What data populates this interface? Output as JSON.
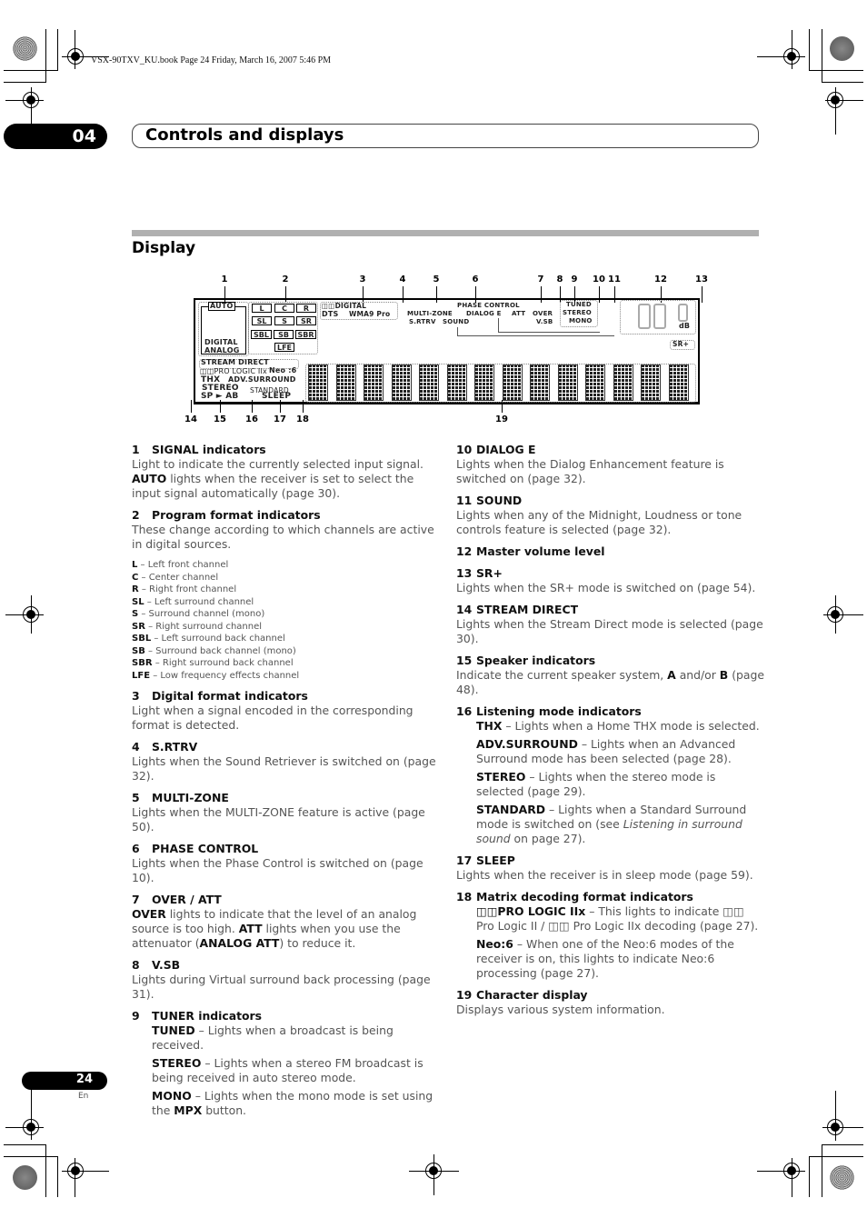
{
  "print_header": "VSX-90TXV_KU.book  Page 24  Friday, March 16, 2007  5:46 PM",
  "chapter": {
    "number": "04",
    "title": "Controls and displays"
  },
  "section": {
    "title": "Display"
  },
  "diagram": {
    "callouts_top": [
      "1",
      "2",
      "3",
      "4",
      "5",
      "6",
      "7",
      "8",
      "9",
      "10",
      "11",
      "12",
      "13"
    ],
    "callouts_bottom": [
      "14",
      "15",
      "16",
      "17",
      "18",
      "19"
    ],
    "indicators": {
      "auto": "AUTO",
      "digital": "DIGITAL",
      "analog": "ANALOG",
      "channels": [
        "L",
        "C",
        "R",
        "SL",
        "S",
        "SR",
        "SBL",
        "SB",
        "SBR",
        "LFE"
      ],
      "dd_digital": "◫◫DIGITAL",
      "dts": "DTS",
      "wma9": "WMA9 Pro",
      "multi_zone": "MULTI-ZONE",
      "s_rtrv": "S.RTRV",
      "sound": "SOUND",
      "phase_control": "PHASE CONTROL",
      "dialog_e": "DIALOG E",
      "att": "ATT",
      "over": "OVER",
      "vsb": "V.SB",
      "tuned": "TUNED",
      "stereo_tuner": "STEREO",
      "mono": "MONO",
      "db": "dB",
      "sr_plus": "SR+",
      "stream_direct": "STREAM DIRECT",
      "pro_logic": "◫◫PRO LOGIC IIx",
      "neo6": "Neo :6",
      "thx": "THX",
      "adv_surround": "ADV.SURROUND",
      "stereo": "STEREO",
      "standard": "STANDARD",
      "sp_ab": "SP ► AB",
      "sleep": "SLEEP"
    }
  },
  "items_left": [
    {
      "num": "1",
      "title": "SIGNAL indicators",
      "body": "Light to indicate the currently selected input signal.",
      "body2_bold": "AUTO",
      "body2": " lights when the receiver is set to select the input signal automatically (page 30)."
    },
    {
      "num": "2",
      "title": "Program format indicators",
      "body": "These change according to which channels are active in digital sources."
    },
    {
      "num": "3",
      "title": "Digital format indicators",
      "body": "Light when a signal encoded in the corresponding format is detected."
    },
    {
      "num": "4",
      "title": "S.RTRV",
      "body": "Lights when the Sound Retriever is switched on (page 32)."
    },
    {
      "num": "5",
      "title": "MULTI-ZONE",
      "body": "Lights when the MULTI-ZONE feature is active (page 50)."
    },
    {
      "num": "6",
      "title": "PHASE CONTROL",
      "body": "Lights when the Phase Control is switched on (page 10)."
    },
    {
      "num": "7",
      "title": "OVER / ATT",
      "b1": "OVER",
      "t1": " lights to indicate that the level of an analog source is too high. ",
      "b2": "ATT",
      "t2": " lights when you use the attenuator (",
      "b3": "ANALOG ATT",
      "t3": ") to reduce it."
    },
    {
      "num": "8",
      "title": "V.SB",
      "body": "Lights during Virtual surround back processing (page 31)."
    },
    {
      "num": "9",
      "title": "TUNER indicators",
      "subs": [
        {
          "bold": "TUNED",
          "text": " – Lights when a broadcast is being received."
        },
        {
          "bold": "STEREO",
          "text": " – Lights when a stereo FM broadcast is being received in auto stereo mode."
        },
        {
          "bold": "MONO",
          "text": " – Lights when the mono mode is set using the ",
          "bold2": "MPX",
          "text2": " button."
        }
      ]
    }
  ],
  "channel_list": [
    {
      "code": "L",
      "desc": " – Left front channel"
    },
    {
      "code": "C",
      "desc": " – Center channel"
    },
    {
      "code": "R",
      "desc": " – Right front channel"
    },
    {
      "code": "SL",
      "desc": " – Left surround channel"
    },
    {
      "code": "S",
      "desc": " – Surround channel (mono)"
    },
    {
      "code": "SR",
      "desc": " – Right surround channel"
    },
    {
      "code": "SBL",
      "desc": " – Left surround back channel"
    },
    {
      "code": "SB",
      "desc": " – Surround back channel (mono)"
    },
    {
      "code": "SBR",
      "desc": " – Right surround back channel"
    },
    {
      "code": "LFE",
      "desc": " – Low frequency effects channel"
    }
  ],
  "items_right": [
    {
      "num": "10",
      "title": "DIALOG E",
      "body": "Lights when the Dialog Enhancement feature is switched on (page 32)."
    },
    {
      "num": "11",
      "title": "SOUND",
      "body": "Lights when any of the Midnight, Loudness or tone controls feature is selected (page 32)."
    },
    {
      "num": "12",
      "title": "Master volume level"
    },
    {
      "num": "13",
      "title": "SR+",
      "body": "Lights when the SR+ mode is switched on (page 54)."
    },
    {
      "num": "14",
      "title": "STREAM DIRECT",
      "body": "Lights when the Stream Direct mode is selected (page 30)."
    },
    {
      "num": "15",
      "title": "Speaker indicators",
      "t1": "Indicate the current speaker system, ",
      "b1": "A",
      "t2": " and/or ",
      "b2": "B",
      "t3": " (page 48)."
    },
    {
      "num": "16",
      "title": "Listening mode indicators",
      "subs": [
        {
          "bold": "THX",
          "text": " – Lights when a Home THX mode is selected."
        },
        {
          "bold": "ADV.SURROUND",
          "text": " – Lights when an Advanced Surround mode has been selected (page 28)."
        },
        {
          "bold": "STEREO",
          "text": " – Lights when the stereo mode is selected (page 29)."
        },
        {
          "bold": "STANDARD",
          "text": " – Lights when a Standard Surround mode is switched on (see ",
          "italic": "Listening in surround sound",
          "text2": " on page 27)."
        }
      ]
    },
    {
      "num": "17",
      "title": "SLEEP",
      "body": "Lights when the receiver is in sleep mode (page 59)."
    },
    {
      "num": "18",
      "title": "Matrix decoding format indicators",
      "subs": [
        {
          "bold": "◫◫PRO LOGIC IIx",
          "text": " – This lights to indicate ◫◫ Pro Logic II / ◫◫ Pro Logic IIx decoding (page 27)."
        },
        {
          "bold": "Neo:6",
          "text": " – When one of the Neo:6 modes of the receiver is on, this lights to indicate Neo:6 processing (page 27)."
        }
      ]
    },
    {
      "num": "19",
      "title": "Character display",
      "body": "Displays various system information."
    }
  ],
  "footer": {
    "page": "24",
    "lang": "En"
  }
}
